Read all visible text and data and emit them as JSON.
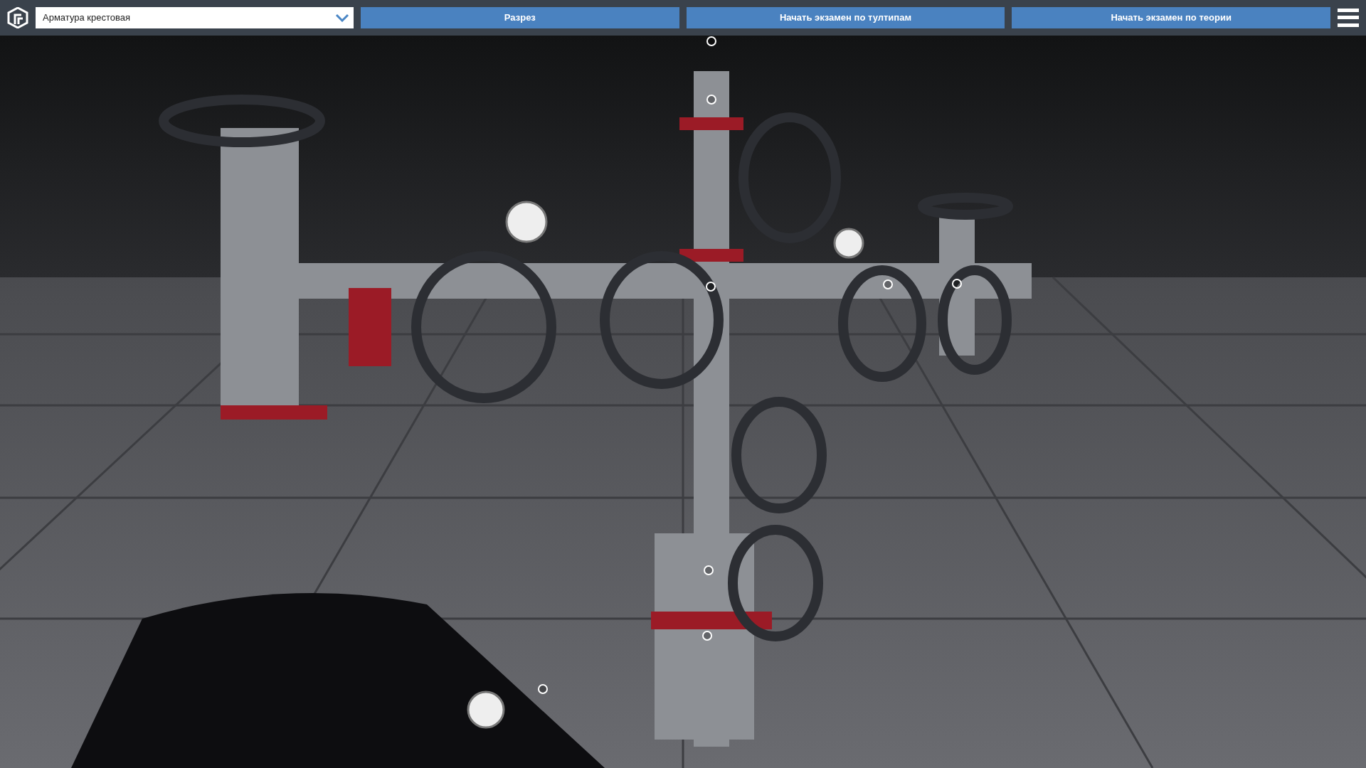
{
  "toolbar": {
    "model_select": {
      "value": "Арматура крестовая"
    },
    "buttons": [
      {
        "label": "Разрез"
      },
      {
        "label": "Начать экзамен по тултипам"
      },
      {
        "label": "Начать экзамен по теории"
      }
    ]
  }
}
